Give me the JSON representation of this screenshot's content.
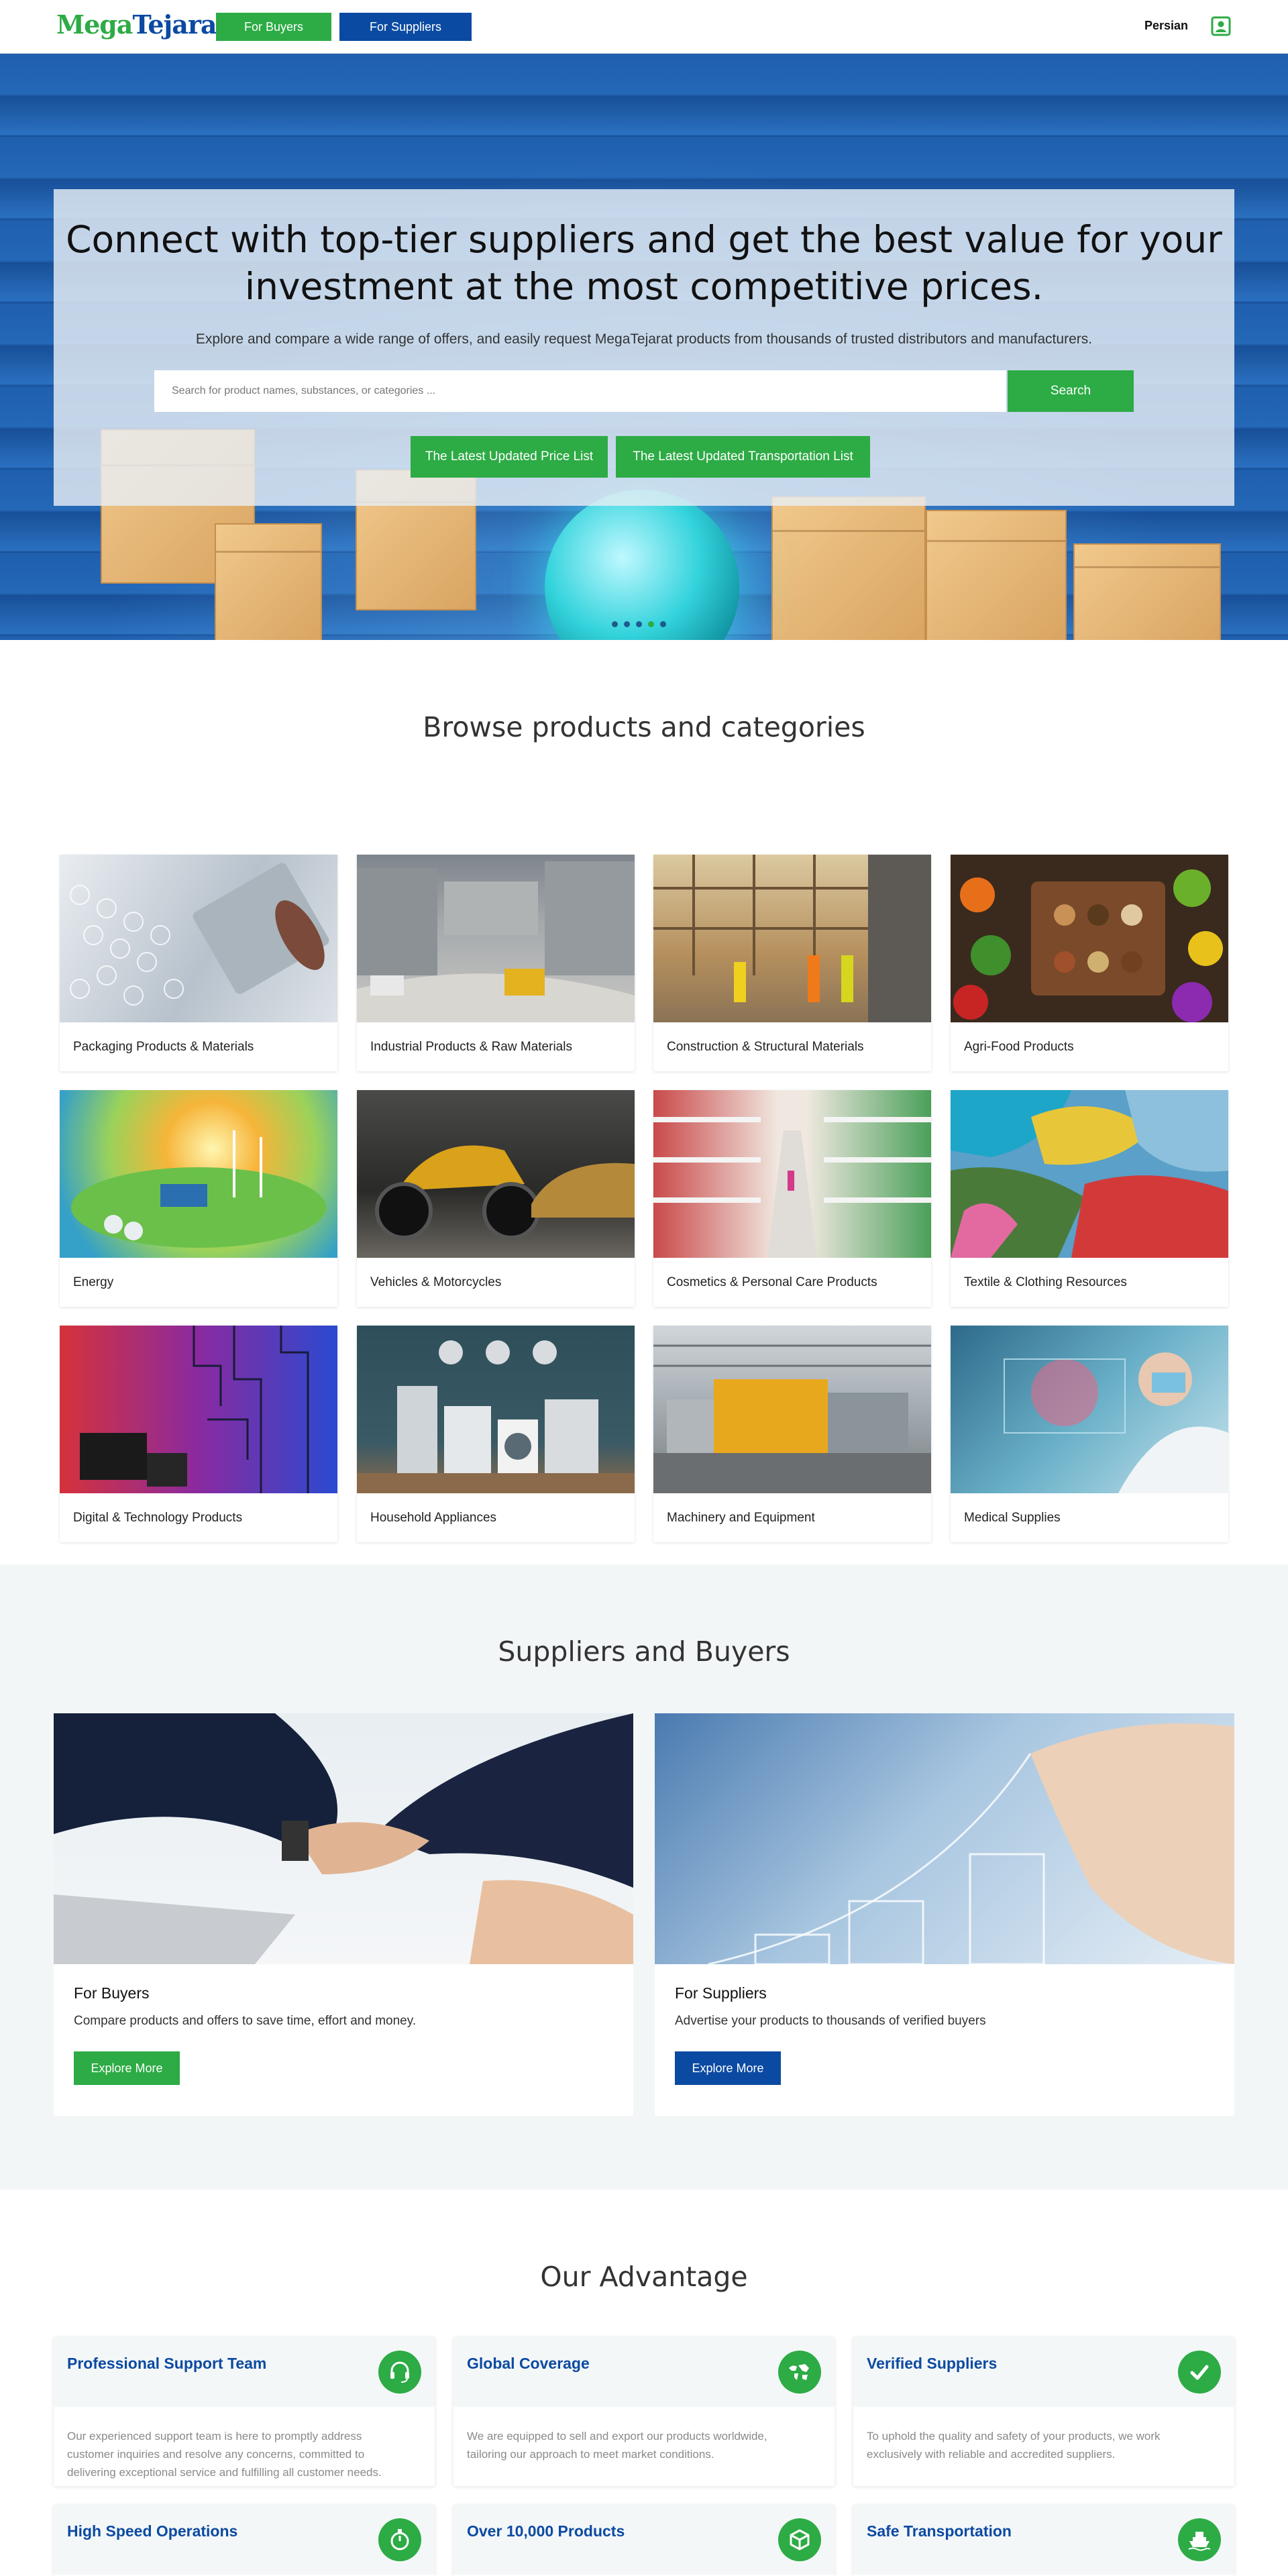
{
  "header": {
    "logo_part1": "Mega",
    "logo_part2": "Tejarat",
    "buyers_label": "For Buyers",
    "suppliers_label": "For Suppliers",
    "language_label": "Persian",
    "user_icon": "user-icon"
  },
  "hero": {
    "title": "Connect with top-tier suppliers and get the best value for your investment at the most competitive prices.",
    "subtitle": "Explore and compare a wide range of offers, and easily request MegaTejarat products from thousands of trusted distributors and manufacturers.",
    "search_placeholder": "Search for product names, substances, or categories ...",
    "search_value": "",
    "search_button": "Search",
    "price_list_button": "The Latest Updated Price List",
    "transport_list_button": "The Latest Updated Transportation List",
    "carousel_active_slide": 4,
    "carousel_slide_count": 6
  },
  "categories": {
    "title": "Browse products and categories",
    "items": [
      {
        "label": "Packaging Products & Materials"
      },
      {
        "label": "Industrial Products & Raw Materials"
      },
      {
        "label": "Construction & Structural Materials"
      },
      {
        "label": "Agri-Food Products"
      },
      {
        "label": "Energy"
      },
      {
        "label": "Vehicles & Motorcycles"
      },
      {
        "label": "Cosmetics & Personal Care Products"
      },
      {
        "label": "Textile & Clothing Resources"
      },
      {
        "label": "Digital & Technology Products"
      },
      {
        "label": "Household Appliances"
      },
      {
        "label": "Machinery and Equipment"
      },
      {
        "label": "Medical Supplies"
      }
    ]
  },
  "suppliers_buyers": {
    "title": "Suppliers and Buyers",
    "buyers": {
      "title": "For Buyers",
      "text": "Compare products and offers to save time, effort and money.",
      "button": "Explore More"
    },
    "suppliers": {
      "title": "For Suppliers",
      "text": "Advertise your products to thousands of verified buyers",
      "button": "Explore More"
    }
  },
  "advantage": {
    "title": "Our Advantage",
    "items": [
      {
        "title": "Professional Support Team",
        "icon": "headset-icon",
        "text": "Our experienced support team is here to promptly address customer inquiries and resolve any concerns, committed to delivering exceptional service and fulfilling all customer needs."
      },
      {
        "title": "Global Coverage",
        "icon": "world-map-icon",
        "text": "We are equipped to sell and export our products worldwide, tailoring our approach to meet market conditions."
      },
      {
        "title": "Verified Suppliers",
        "icon": "checkmark-icon",
        "text": "To uphold the quality and safety of your products, we work exclusively with reliable and accredited suppliers."
      },
      {
        "title": "High Speed Operations",
        "icon": "stopwatch-icon",
        "text": ""
      },
      {
        "title": "Over 10,000 Products",
        "icon": "cube-icon",
        "text": ""
      },
      {
        "title": "Safe Transportation",
        "icon": "ship-icon",
        "text": ""
      }
    ]
  },
  "colors": {
    "brand_green": "#2dab45",
    "brand_blue": "#0b4aa2"
  }
}
